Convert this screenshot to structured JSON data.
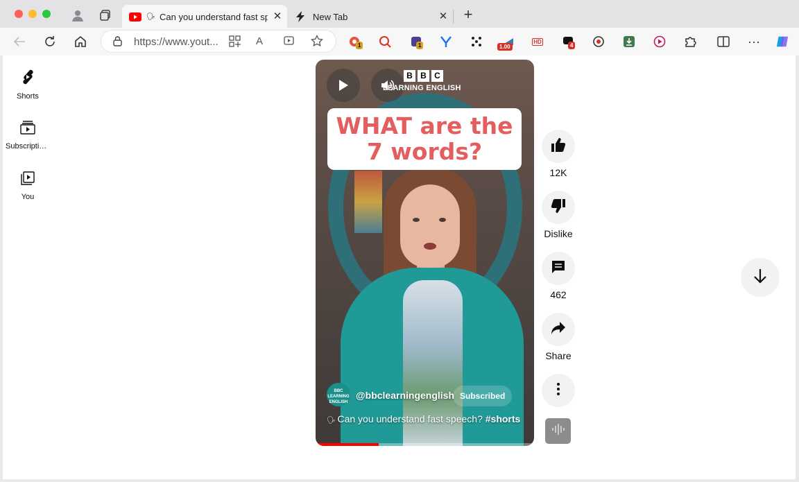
{
  "browser": {
    "tabs": [
      {
        "title": "Can you understand fast speech? #shorts",
        "active": true
      },
      {
        "title": "New Tab",
        "active": false
      }
    ],
    "url": "https://www.youtube.com/shorts/",
    "url_display": "https://www.yout...",
    "extensions": [
      {
        "name": "ext-red-circle-icon",
        "badge": "1"
      },
      {
        "name": "ext-magnifier-icon",
        "badge": ""
      },
      {
        "name": "ext-puzzle-dark-icon",
        "badge": "1"
      },
      {
        "name": "ext-y-logo-icon",
        "badge": ""
      },
      {
        "name": "ext-scatter-icon",
        "badge": ""
      },
      {
        "name": "ext-speed-icon",
        "badge": "1.00"
      },
      {
        "name": "ext-hd-icon",
        "badge": ""
      },
      {
        "name": "ext-chat-icon",
        "badge": "4"
      },
      {
        "name": "ext-record-icon",
        "badge": ""
      },
      {
        "name": "ext-download-icon",
        "badge": ""
      },
      {
        "name": "ext-play-circle-icon",
        "badge": ""
      }
    ],
    "colors": {
      "accent": "#ff0000",
      "caption": "#e35f5f",
      "badge_yellow": "#d6a021",
      "badge_red": "#d93025"
    }
  },
  "sidebar": {
    "items": [
      {
        "label": "Shorts",
        "icon": "shorts-icon"
      },
      {
        "label": "Subscriptions",
        "icon": "subscriptions-icon"
      },
      {
        "label": "You",
        "icon": "you-icon"
      }
    ]
  },
  "video": {
    "brand_letters": [
      "B",
      "B",
      "C"
    ],
    "brand_sub": "LEARNING ENGLISH",
    "caption_lines": [
      "WHAT are the",
      "7 words?"
    ],
    "channel_handle": "@bbclearningenglish",
    "avatar_text": "BBC LEARNING ENGLISH",
    "subscribe_label": "Subscribed",
    "title": "Can you understand fast speech?",
    "hashtag": "#shorts",
    "progress": 0.29
  },
  "actions": {
    "like_count": "12K",
    "dislike_label": "Dislike",
    "comment_count": "462",
    "share_label": "Share"
  }
}
